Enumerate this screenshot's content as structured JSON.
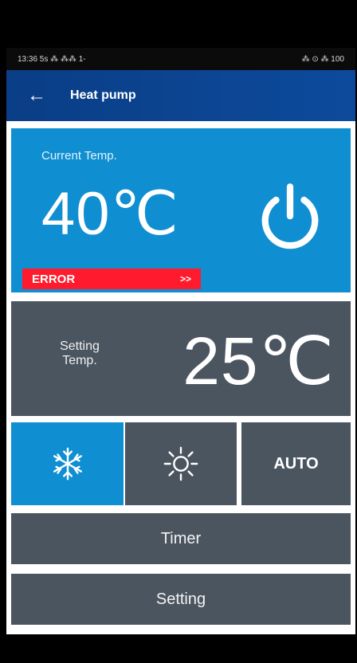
{
  "status_bar": {
    "left": "13:36 5s ⁂ ⁂⁂ 1-",
    "right": "⁂ ⊙ ⁂ 100"
  },
  "app_bar": {
    "back_icon": "arrow-left-icon",
    "title": "Heat pump"
  },
  "current_temp": {
    "label": "Current Temp.",
    "value": "40℃",
    "power_icon": "power-icon",
    "error_label": "ERROR",
    "error_arrow": ">>"
  },
  "setting_temp": {
    "label": "Setting\nTemp.",
    "value": "25℃"
  },
  "modes": [
    {
      "name": "cool",
      "icon": "snowflake-icon"
    },
    {
      "name": "heat",
      "icon": "sun-icon"
    },
    {
      "name": "auto",
      "label": "AUTO"
    }
  ],
  "buttons": {
    "timer": "Timer",
    "setting": "Setting"
  },
  "colors": {
    "appbar": "#0d4a9c",
    "current_bg": "#0f8fd1",
    "panel_bg": "#4b5560",
    "error": "#ff1b2d"
  }
}
